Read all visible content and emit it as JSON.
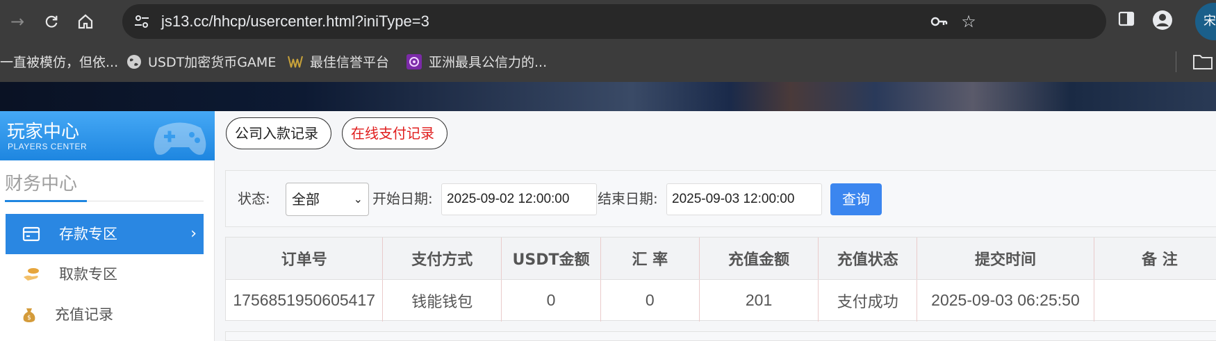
{
  "browser": {
    "url": "js13.cc/hhcp/usercenter.html?iniType=3",
    "profile_initial": "宋",
    "bookmarks": [
      {
        "label": "一直被模仿，但依...",
        "icon": "none"
      },
      {
        "label": "USDT加密货币GAME",
        "icon": "globe-icon"
      },
      {
        "label": "最佳信誉平台",
        "icon": "site-logo-icon"
      },
      {
        "label": "亚洲最具公信力的...",
        "icon": "purple-logo-icon"
      }
    ]
  },
  "sidebar": {
    "header_title": "玩家中心",
    "header_subtitle": "PLAYERS CENTER",
    "section_title": "财务中心",
    "items": [
      {
        "label": "存款专区",
        "icon": "card-icon",
        "active": true
      },
      {
        "label": "取款专区",
        "icon": "hand-coin-icon",
        "active": false
      },
      {
        "label": "充值记录",
        "icon": "money-bag-icon",
        "active": false
      }
    ]
  },
  "tabs": {
    "company_deposit": "公司入款记录",
    "online_payment": "在线支付记录"
  },
  "filter": {
    "status_label": "状态:",
    "status_value": "全部",
    "start_label": "开始日期:",
    "start_value": "2025-09-02 12:00:00",
    "end_label": "结束日期:",
    "end_value": "2025-09-03 12:00:00",
    "query_label": "查询"
  },
  "table": {
    "headers": [
      "订单号",
      "支付方式",
      "USDT金额",
      "汇 率",
      "充值金额",
      "充值状态",
      "提交时间",
      "备 注"
    ],
    "rows": [
      [
        "1756851950605417",
        "钱能钱包",
        "0",
        "0",
        "201",
        "支付成功",
        "2025-09-03 06:25:50",
        ""
      ]
    ]
  },
  "colors": {
    "accent": "#2a87e2",
    "query_button": "#3b86ef",
    "online_tab_text": "#e01d1d"
  }
}
